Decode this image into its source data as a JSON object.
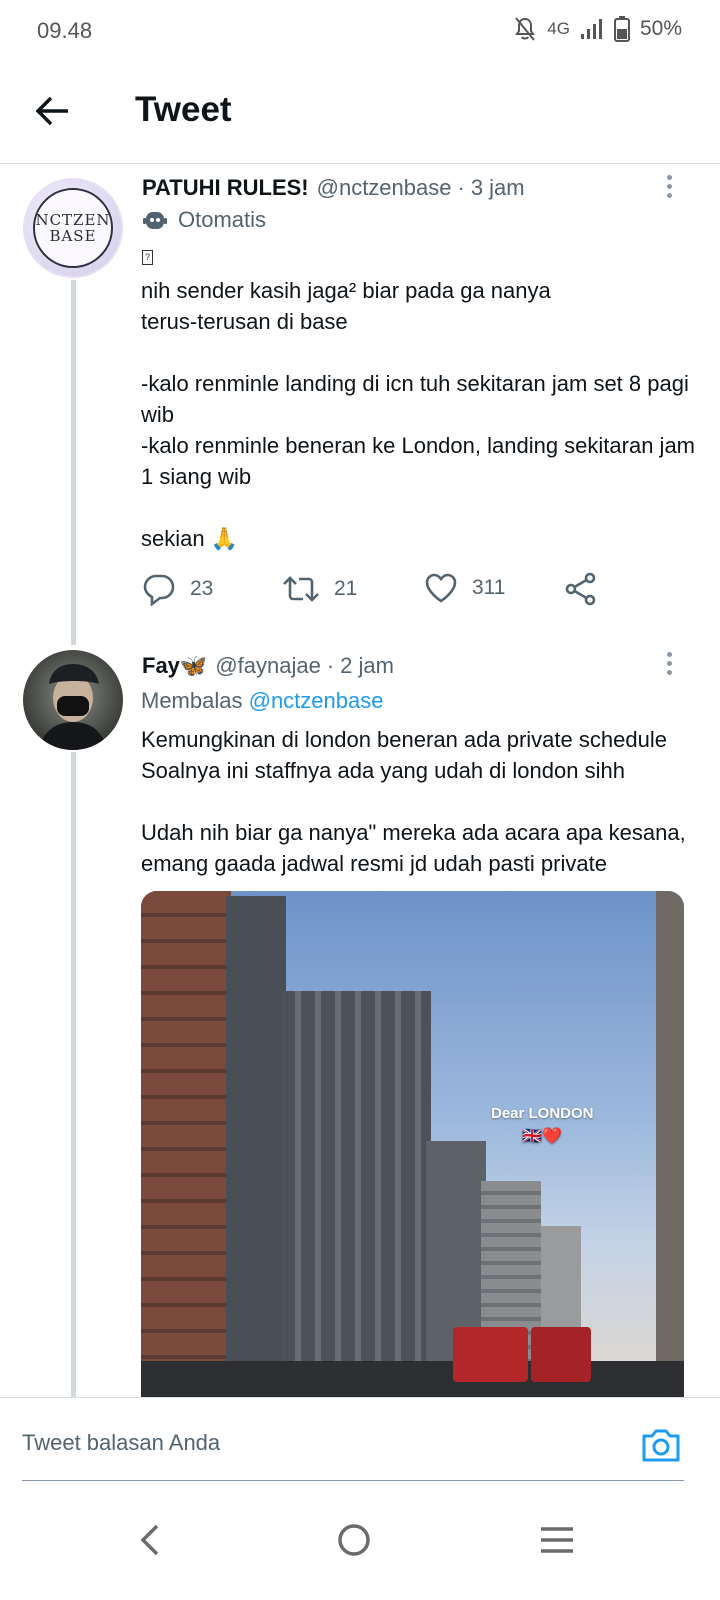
{
  "status_bar": {
    "time": "09.48",
    "network": "4G",
    "battery": "50%"
  },
  "header": {
    "title": "Tweet"
  },
  "tweets": [
    {
      "name": "PATUHI RULES!",
      "handle": "@nctzenbase",
      "dot": "·",
      "time": "3 jam",
      "automated_label": "Otomatis",
      "avatar_text": [
        "NCTZEN",
        "BASE"
      ],
      "glyph": "?",
      "text": "nih sender kasih jaga² biar pada ga nanya\nterus-terusan di base\n\n-kalo renminle landing di icn tuh sekitaran jam set 8 pagi wib\n-kalo renminle beneran ke London, landing sekitaran jam 1 siang wib\n\nsekian 🙏",
      "replies": "23",
      "retweets": "21",
      "likes": "311"
    },
    {
      "name": "Fay🦋",
      "handle": "@faynajae",
      "dot": "·",
      "time": "2 jam",
      "reply_label": "Membalas",
      "reply_mention": "@nctzenbase",
      "text": "Kemungkinan di london beneran ada private schedule\nSoalnya ini staffnya ada yang udah di london sihh\n\nUdah nih biar ga nanya\" mereka ada acara apa kesana, emang gaada jadwal resmi jd udah pasti private",
      "photo_caption": "Dear LONDON",
      "photo_flags": "🇬🇧❤️"
    }
  ],
  "composer": {
    "placeholder": "Tweet balasan Anda"
  },
  "colors": {
    "accent": "#1d9bf0",
    "secondary_text": "#536471",
    "thread_line": "#cfd9de"
  },
  "icons": [
    "back-arrow-icon",
    "reply-icon",
    "retweet-icon",
    "like-icon",
    "share-icon",
    "robot-icon",
    "camera-icon",
    "more-icon"
  ]
}
